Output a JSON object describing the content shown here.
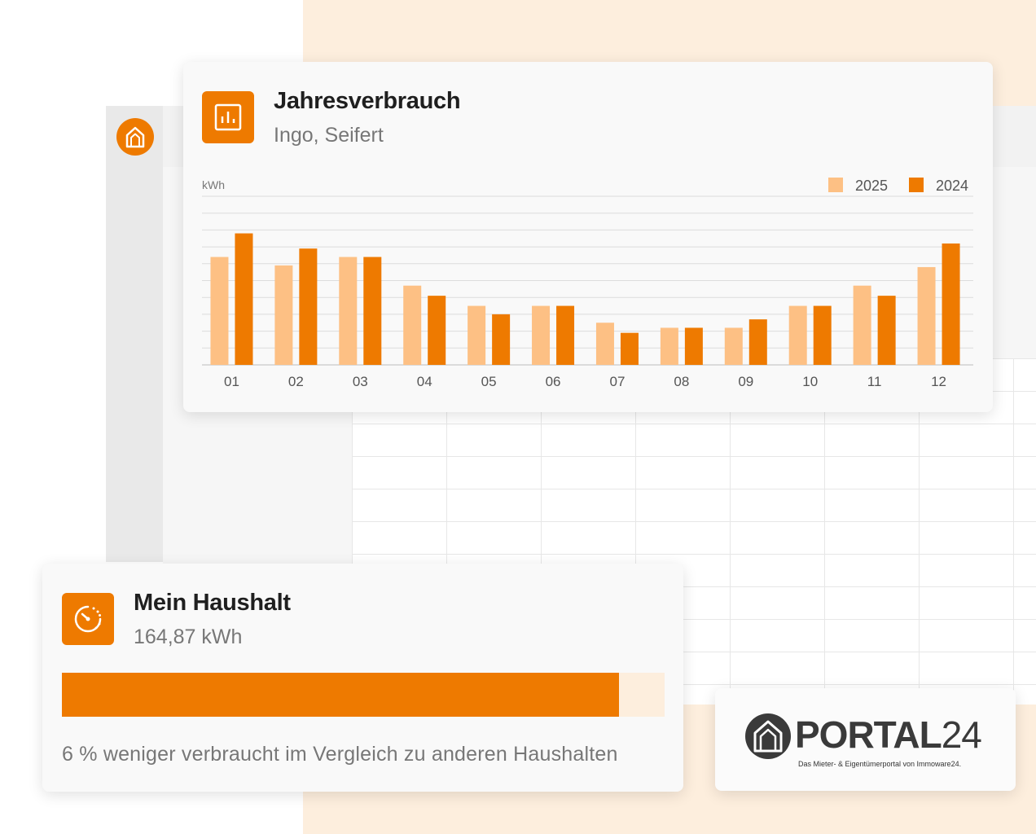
{
  "colors": {
    "accent": "#ee7a00",
    "accent_light": "#fdc084",
    "peach": "#fdeedd"
  },
  "icons": {
    "app_logo": "house-icon",
    "chart_card": "bar-chart-icon",
    "household_card": "gauge-icon",
    "brand": "house-icon"
  },
  "chart_card": {
    "title": "Jahresverbrauch",
    "subtitle": "Ingo, Seifert"
  },
  "chart_data": {
    "type": "bar",
    "ylabel": "kWh",
    "categories": [
      "01",
      "02",
      "03",
      "04",
      "05",
      "06",
      "07",
      "08",
      "09",
      "10",
      "11",
      "12"
    ],
    "series": [
      {
        "name": "2025",
        "color": "#fdc084",
        "values": [
          6.4,
          5.9,
          6.4,
          4.7,
          3.5,
          3.5,
          2.5,
          2.2,
          2.2,
          3.5,
          4.7,
          5.8
        ]
      },
      {
        "name": "2024",
        "color": "#ee7a00",
        "values": [
          7.8,
          6.9,
          6.4,
          4.1,
          3.0,
          3.5,
          1.9,
          2.2,
          2.7,
          3.5,
          4.1,
          7.2
        ]
      }
    ],
    "ylim": [
      0,
      10
    ],
    "grid": true,
    "legend": "top-right"
  },
  "household_card": {
    "title": "Mein Haushalt",
    "value": "164,87 kWh",
    "progress_fraction": 0.924,
    "comparison": "6 % weniger verbraucht im Vergleich zu anderen Haushalten"
  },
  "brand": {
    "word": "PORTAL",
    "number": "24",
    "tagline": "Das Mieter- & Eigentümerportal von Immoware24."
  }
}
